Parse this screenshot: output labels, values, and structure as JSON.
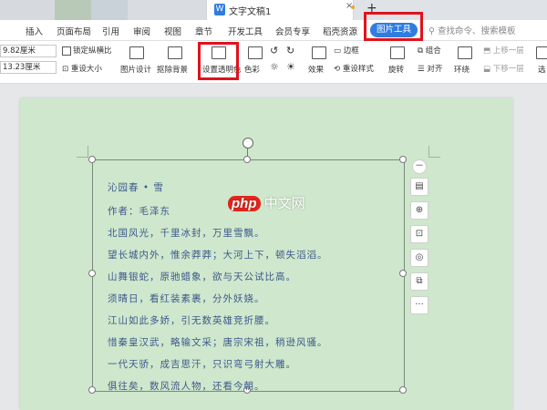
{
  "window": {
    "doc_title": "文字文稿1",
    "close_glyph": "×",
    "new_tab_glyph": "+"
  },
  "menu": {
    "tabs": [
      "插入",
      "页面布局",
      "引用",
      "审阅",
      "视图",
      "章节",
      "开发工具",
      "会员专享",
      "稻壳资源"
    ],
    "picture_tool": "图片工具",
    "search_placeholder": "查找命令、搜索模板"
  },
  "ribbon": {
    "height_value": "9.82厘米",
    "width_value": "13.23厘米",
    "lock_ratio": "锁定纵横比",
    "reset_size": "重设大小",
    "picture_design": "图片设计",
    "remove_bg": "抠除背景",
    "set_transparent": "设置透明色",
    "color": "色彩",
    "effect": "效果",
    "border": "边框",
    "reset_style": "重设样式",
    "rotate": "旋转",
    "group": "组合",
    "align": "对齐",
    "wrap": "环绕",
    "up_layer": "上移一层",
    "down_layer": "下移一层",
    "select": "选"
  },
  "poem": {
    "lines": [
      "沁园春 • 雪",
      "作者：毛泽东",
      "北国风光，千里冰封，万里雪飘。",
      "望长城内外，惟余莽莽；大河上下，顿失滔滔。",
      "山舞银蛇，原驰蜡象，欲与天公试比高。",
      "须晴日，看红装素裹，分外妖娆。",
      "江山如此多娇，引无数英雄竞折腰。",
      "惜秦皇汉武，略输文采；唐宗宋祖，稍逊风骚。",
      "一代天骄，成吉思汗，只识弯弓射大雕。",
      "俱往矣，数风流人物，还看今朝。"
    ]
  },
  "watermark": {
    "php": "php",
    "site": "中文网"
  },
  "side_tools": [
    "－",
    "▤",
    "⊕",
    "⊡",
    "◎",
    "⧉",
    "···"
  ]
}
